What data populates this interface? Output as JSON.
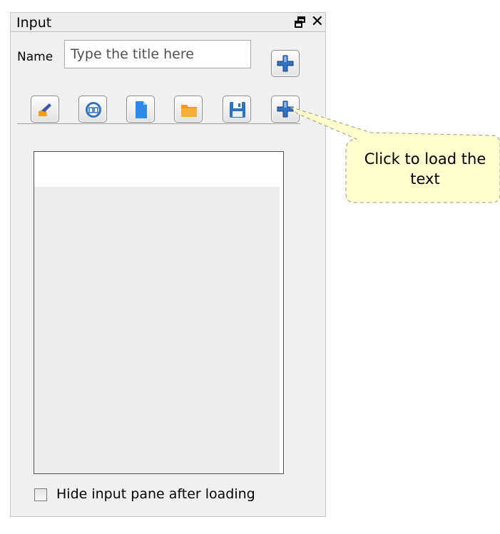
{
  "panel": {
    "title": "Input"
  },
  "form": {
    "name_label": "Name",
    "name_placeholder": "Type the title here",
    "name_value": ""
  },
  "toolbar": {
    "buttons": [
      {
        "icon": "clear-brush-icon"
      },
      {
        "icon": "open-book-icon"
      },
      {
        "icon": "new-document-icon"
      },
      {
        "icon": "open-folder-icon"
      },
      {
        "icon": "save-disk-icon"
      },
      {
        "icon": "load-text-icon"
      }
    ]
  },
  "options": {
    "hide_pane_label": "Hide input pane after loading",
    "hide_pane_checked": false
  },
  "tooltip": {
    "text": "Click to load the text"
  },
  "colors": {
    "panel_bg": "#f0f0f0",
    "tooltip_bg": "#fefecf",
    "icon_blue": "#2f72c0",
    "icon_orange": "#f39a18"
  }
}
